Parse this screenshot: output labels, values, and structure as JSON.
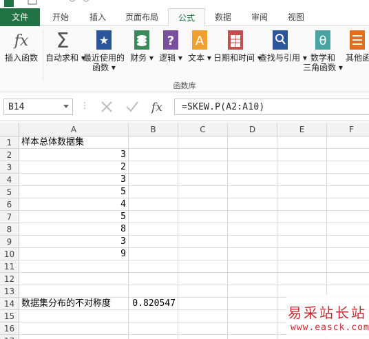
{
  "tabs": [
    "文件",
    "开始",
    "插入",
    "页面布局",
    "公式",
    "数据",
    "审阅",
    "视图"
  ],
  "active_tab": "公式",
  "ribbon": {
    "buttons": [
      {
        "label": "插入函数",
        "label2": ""
      },
      {
        "label": "自动求和",
        "label2": ""
      },
      {
        "label": "最近使用的",
        "label2": "函数"
      },
      {
        "label": "财务",
        "label2": ""
      },
      {
        "label": "逻辑",
        "label2": ""
      },
      {
        "label": "文本",
        "label2": ""
      },
      {
        "label": "日期和时间",
        "label2": ""
      },
      {
        "label": "查找与引用",
        "label2": ""
      },
      {
        "label": "数学和",
        "label2": "三角函数"
      },
      {
        "label": "其他函",
        "label2": ""
      }
    ],
    "group_label": "函数库",
    "icon_text": {
      "fx": "fx",
      "sigma": "Σ",
      "star": "★",
      "logic": "?",
      "text": "A",
      "math": "θ"
    }
  },
  "formula_bar": {
    "name_box": "B14",
    "dots": "⋮",
    "fx_label": "fx",
    "formula": "=SKEW.P(A2:A10)"
  },
  "sheet": {
    "columns": [
      "A",
      "B",
      "C",
      "D",
      "E",
      "F"
    ],
    "rows": [
      {
        "n": "1",
        "a": "样本总体数据集",
        "b": ""
      },
      {
        "n": "2",
        "a": "3",
        "b": ""
      },
      {
        "n": "3",
        "a": "2",
        "b": ""
      },
      {
        "n": "4",
        "a": "3",
        "b": ""
      },
      {
        "n": "5",
        "a": "5",
        "b": ""
      },
      {
        "n": "6",
        "a": "4",
        "b": ""
      },
      {
        "n": "7",
        "a": "5",
        "b": ""
      },
      {
        "n": "8",
        "a": "8",
        "b": ""
      },
      {
        "n": "9",
        "a": "3",
        "b": ""
      },
      {
        "n": "10",
        "a": "9",
        "b": ""
      },
      {
        "n": "11",
        "a": "",
        "b": ""
      },
      {
        "n": "12",
        "a": "",
        "b": ""
      },
      {
        "n": "13",
        "a": "",
        "b": ""
      },
      {
        "n": "14",
        "a": "数据集分布的不对称度",
        "b": "0.820547"
      },
      {
        "n": "15",
        "a": "",
        "b": ""
      },
      {
        "n": "16",
        "a": "",
        "b": ""
      },
      {
        "n": "17",
        "a": "",
        "b": ""
      }
    ]
  },
  "watermark": {
    "title": "易采站长站",
    "url": "www.easck.com"
  },
  "colors": {
    "file_tab": "#217346",
    "accent": "#217346",
    "watermark": "#c1272d"
  }
}
